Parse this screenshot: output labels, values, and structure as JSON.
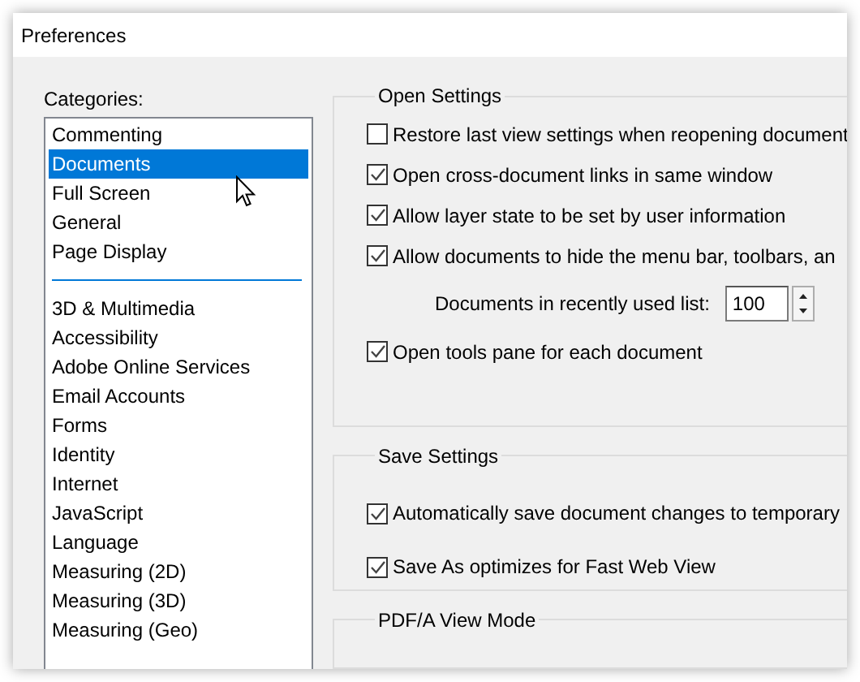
{
  "window": {
    "title": "Preferences"
  },
  "categories": {
    "label": "Categories:",
    "primary_items": [
      {
        "label": "Commenting",
        "selected": false
      },
      {
        "label": "Documents",
        "selected": true
      },
      {
        "label": "Full Screen",
        "selected": false
      },
      {
        "label": "General",
        "selected": false
      },
      {
        "label": "Page Display",
        "selected": false
      }
    ],
    "other_items": [
      {
        "label": "3D & Multimedia",
        "selected": false
      },
      {
        "label": "Accessibility",
        "selected": false
      },
      {
        "label": "Adobe Online Services",
        "selected": false
      },
      {
        "label": "Email Accounts",
        "selected": false
      },
      {
        "label": "Forms",
        "selected": false
      },
      {
        "label": "Identity",
        "selected": false
      },
      {
        "label": "Internet",
        "selected": false
      },
      {
        "label": "JavaScript",
        "selected": false
      },
      {
        "label": "Language",
        "selected": false
      },
      {
        "label": "Measuring (2D)",
        "selected": false
      },
      {
        "label": "Measuring (3D)",
        "selected": false
      },
      {
        "label": "Measuring (Geo)",
        "selected": false
      }
    ]
  },
  "open_settings": {
    "title": "Open Settings",
    "options": [
      {
        "kind": "checkbox",
        "label": "Restore last view settings when reopening document",
        "checked": false
      },
      {
        "kind": "checkbox",
        "label": "Open cross-document links in same window",
        "checked": true
      },
      {
        "kind": "checkbox",
        "label": "Allow layer state to be set by user information",
        "checked": true
      },
      {
        "kind": "checkbox",
        "label": "Allow documents to hide the menu bar, toolbars, an",
        "checked": true
      },
      {
        "kind": "spin",
        "label": "Documents in recently used list:",
        "value": "100"
      },
      {
        "kind": "checkbox",
        "label": "Open tools pane for each document",
        "checked": true
      }
    ]
  },
  "save_settings": {
    "title": "Save Settings",
    "options": [
      {
        "label": "Automatically save document changes to temporary",
        "checked": true
      },
      {
        "label": "Save As optimizes for Fast Web View",
        "checked": true
      }
    ]
  },
  "pdfa_view_mode": {
    "title": "PDF/A View Mode"
  }
}
